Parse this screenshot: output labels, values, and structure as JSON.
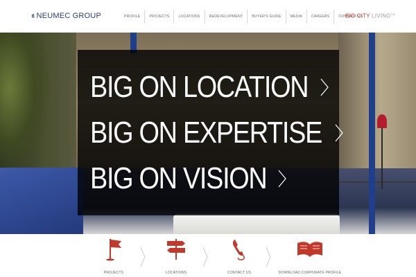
{
  "header": {
    "logo_text": "NEUMEC GROUP",
    "nav": [
      {
        "label": "PROFILE",
        "name": "profile"
      },
      {
        "label": "PROJECTS",
        "name": "projects"
      },
      {
        "label": "LOCATIONS",
        "name": "locations"
      },
      {
        "label": "REDEVELOPMENT",
        "name": "redevelopment"
      },
      {
        "label": "BUYER'S GUIDE",
        "name": "buyers-guide"
      },
      {
        "label": "MEDIA",
        "name": "media"
      },
      {
        "label": "CAREERS",
        "name": "careers"
      },
      {
        "label": "CONTACT US",
        "name": "contact-us"
      }
    ],
    "tagline_a": "BIG CITY",
    "tagline_b": " LIVING",
    "tagline_mark": "TM"
  },
  "hero": {
    "slogans": [
      "BIG ON LOCATION",
      "BIG ON EXPERTISE",
      "BIG ON VISION"
    ]
  },
  "footer": {
    "items": [
      {
        "label": "PROJECTS",
        "icon": "flag-icon"
      },
      {
        "label": "LOCATIONS",
        "icon": "signpost-icon"
      },
      {
        "label": "CONTACT US",
        "icon": "phone-icon"
      },
      {
        "label": "DOWNLOAD CORPORATE PROFILE",
        "icon": "open-book-icon"
      }
    ]
  },
  "colors": {
    "brand_navy": "#2a3f6e",
    "accent_red": "#c0392b",
    "overlay": "#000000"
  }
}
